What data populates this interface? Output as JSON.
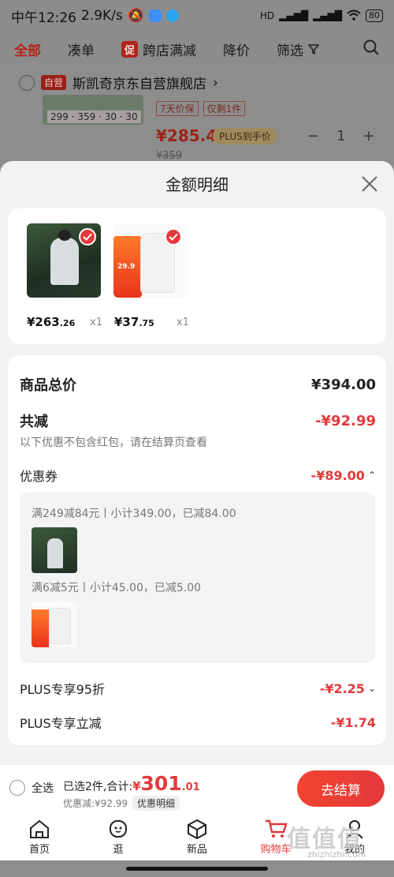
{
  "status": {
    "time": "中午12:26",
    "speed": "2.9K/s",
    "battery": "80",
    "network": "HD"
  },
  "tabs": [
    {
      "label": "全部",
      "active": true
    },
    {
      "label": "凑单"
    },
    {
      "label": "跨店满减",
      "chip": "促"
    },
    {
      "label": "降价"
    },
    {
      "label": "筛选"
    }
  ],
  "background": {
    "shop_tag": "自营",
    "shop_name": "斯凯奇京东自营旗舰店",
    "thumb_price": "299 · 359 · 30 · 30",
    "tags": [
      "7天价保",
      "仅剩1件"
    ],
    "price": "¥285.41",
    "plus_label": "PLUS到手价",
    "qty": "1",
    "old_price": "¥359"
  },
  "sheet": {
    "title": "金额明细",
    "products": [
      {
        "price_main": "¥263",
        "price_dec": ".26",
        "qty": "x1"
      },
      {
        "price_main": "¥37",
        "price_dec": ".75",
        "qty": "x1"
      }
    ],
    "product2_promo": "29.9",
    "total_label": "商品总价",
    "total_value": "¥394.00",
    "reduce_label": "共减",
    "reduce_value": "-¥92.99",
    "reduce_note": "以下优惠不包含红包，请在结算页查看",
    "coupon_label": "优惠券",
    "coupon_value": "-¥89.00",
    "coupon_lines": [
      "满249减84元丨小计349.00，已减84.00",
      "满6减5元丨小计45.00，已减5.00"
    ],
    "plus95_label": "PLUS专享95折",
    "plus95_value": "-¥2.25",
    "plus_reduce_label": "PLUS专享立减",
    "plus_reduce_value": "-¥1.74"
  },
  "bottom": {
    "select_all": "全选",
    "selected_text": "已选2件,合计:",
    "total_symbol": "¥",
    "total_main": "301",
    "total_dec": ".01",
    "discount_text": "优惠减:¥92.99",
    "detail_button": "优惠明细",
    "checkout_button": "去结算"
  },
  "nav": [
    {
      "label": "首页",
      "icon": "home-icon"
    },
    {
      "label": "逛",
      "icon": "face-icon"
    },
    {
      "label": "新品",
      "icon": "cube-icon"
    },
    {
      "label": "购物车",
      "icon": "cart-icon",
      "active": true
    },
    {
      "label": "我的",
      "icon": "user-icon"
    }
  ],
  "watermark": {
    "main": "值值值",
    "sub": "zhizhizhi.com"
  },
  "colors": {
    "accent": "#e4393c",
    "sheet_bg": "#f2f2f2"
  }
}
